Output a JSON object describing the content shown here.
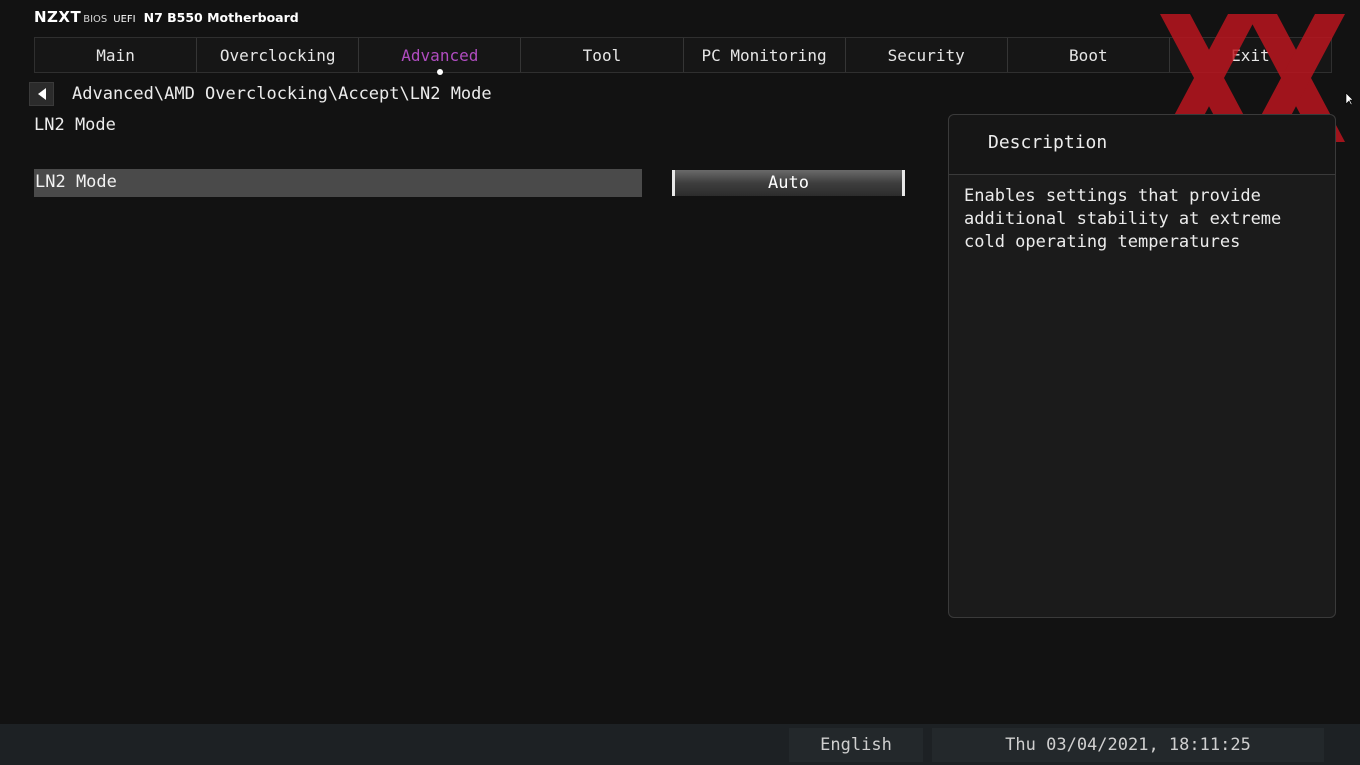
{
  "brand": {
    "logo": "NZXT",
    "bios": "BIOS",
    "uefi": "UEFI",
    "board": "N7 B550 Motherboard"
  },
  "tabs": [
    {
      "label": "Main"
    },
    {
      "label": "Overclocking"
    },
    {
      "label": "Advanced",
      "active": true
    },
    {
      "label": "Tool"
    },
    {
      "label": "PC Monitoring"
    },
    {
      "label": "Security"
    },
    {
      "label": "Boot"
    },
    {
      "label": "Exit"
    }
  ],
  "breadcrumb": "Advanced\\AMD Overclocking\\Accept\\LN2 Mode",
  "page_title": "LN2 Mode",
  "setting": {
    "label": "LN2 Mode",
    "value": "Auto"
  },
  "description": {
    "title": "Description",
    "text": "Enables settings that provide additional stability at extreme cold operating temperatures"
  },
  "footer": {
    "language": "English",
    "datetime": "Thu 03/04/2021, 18:11:25"
  },
  "colors": {
    "accent": "#b04cc0",
    "watermark": "#c0151f",
    "background": "#121212"
  },
  "icons": {
    "back": "back-arrow-icon",
    "watermark": "red-x-watermark-icon",
    "cursor": "mouse-cursor-icon"
  }
}
